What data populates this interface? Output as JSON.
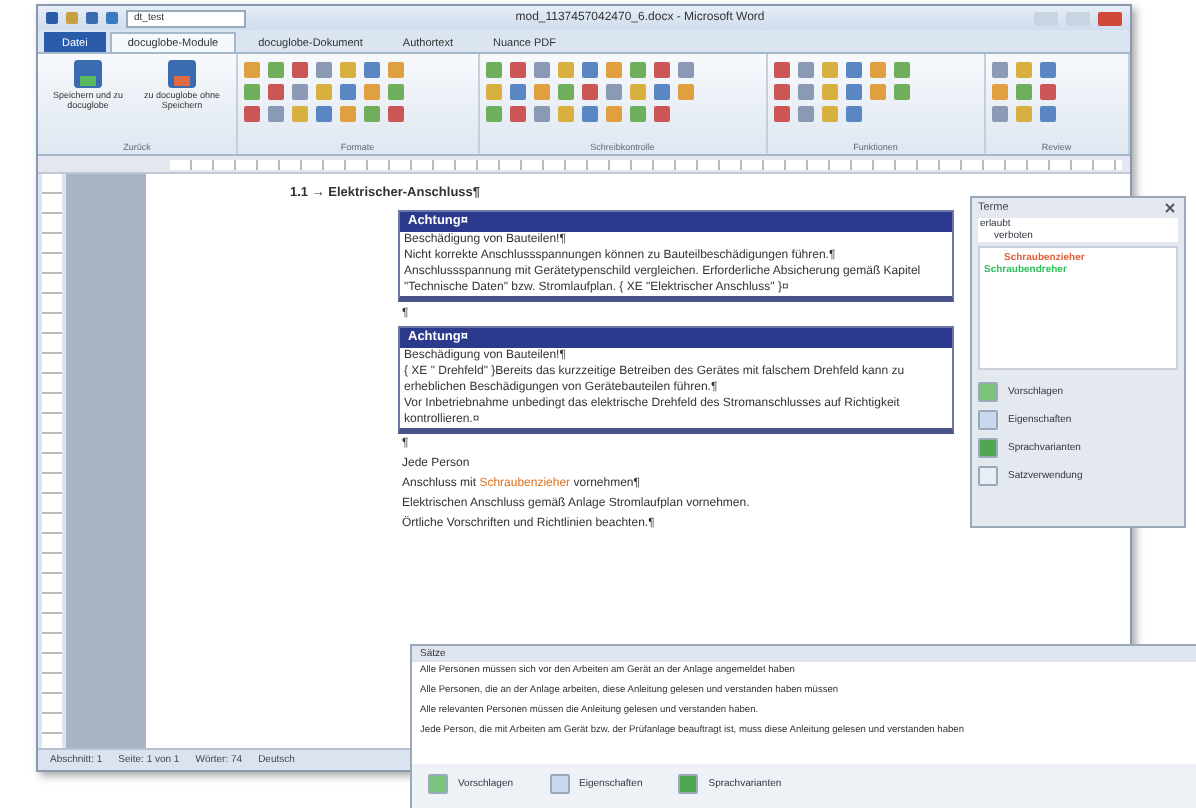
{
  "window": {
    "title": "mod_1137457042470_6.docx - Microsoft Word",
    "quick_access_field": "dt_test"
  },
  "tabs": [
    {
      "label": "Datei",
      "kind": "file",
      "selected": false
    },
    {
      "label": "docuglobe-Module",
      "kind": "tab",
      "selected": true
    },
    {
      "label": "docuglobe-Dokument",
      "kind": "tab",
      "selected": false
    },
    {
      "label": "Authortext",
      "kind": "tab",
      "selected": false
    },
    {
      "label": "Nuance PDF",
      "kind": "tab",
      "selected": false
    }
  ],
  "ribbon_groups": [
    {
      "label": "Zurück",
      "buttons": [
        "Speichern und zu docuglobe",
        "zu docuglobe ohne Speichern"
      ]
    },
    {
      "label": "Formate"
    },
    {
      "label": "Schreibkontrolle"
    },
    {
      "label": "Funktionen"
    },
    {
      "label": "Review"
    }
  ],
  "document": {
    "heading": "1.1 → Elektrischer-Anschluss¶",
    "notes": [
      {
        "title": "Achtung¤",
        "lines": [
          "Beschädigung von Bauteilen!¶",
          "Nicht korrekte Anschlussspannungen können zu Bauteilbeschädigungen führen.¶",
          "Anschlussspannung mit Gerätetypenschild vergleichen. Erforderliche Absicherung gemäß Kapitel \"Technische Daten\" bzw. Stromlaufplan. { XE \"Elektrischer Anschluss\" }¤"
        ]
      },
      {
        "title": "Achtung¤",
        "lines": [
          "Beschädigung von Bauteilen!¶",
          "{ XE \" Drehfeld\" }Bereits das kurzzeitige Betreiben des Gerätes mit falschem Drehfeld kann zu erheblichen Beschädigungen von Gerätebauteilen führen.¶",
          "Vor Inbetriebnahme unbedingt das elektrische Drehfeld des Stromanschlusses auf Richtigkeit kontrollieren.¤"
        ]
      }
    ],
    "between": "¶",
    "paragraphs": [
      [
        {
          "text": "¶",
          "kind": "plain"
        }
      ],
      [
        {
          "text": "Jede Person",
          "kind": "plain"
        }
      ],
      [
        {
          "text": "Anschluss mit ",
          "kind": "plain"
        },
        {
          "text": "Schraubenzieher",
          "kind": "flagged"
        },
        {
          "text": " vornehmen¶",
          "kind": "plain"
        }
      ],
      [
        {
          "text": "Elektrischen Anschluss gemäß Anlage Stromlaufplan vornehmen.",
          "kind": "plain"
        }
      ],
      [
        {
          "text": "Örtliche Vorschriften und Richtlinien beachten.¶",
          "kind": "plain"
        }
      ]
    ]
  },
  "status_bar": [
    "Abschnitt: 1",
    "Seite: 1 von 1",
    "Wörter: 74",
    "Deutsch"
  ],
  "terms_pane": {
    "title": "Terme",
    "tree": [
      {
        "label": "erlaubt",
        "children": [
          {
            "label": "verboten"
          }
        ]
      }
    ],
    "terms": [
      {
        "label": "Schraubenzieher",
        "color": "#e0603a"
      },
      {
        "label": "Schraubendreher",
        "color": "#2fbf5a"
      }
    ],
    "actions": [
      {
        "label": "Vorschlagen",
        "kind": "suggest"
      },
      {
        "label": "Eigenschaften",
        "kind": "properties"
      },
      {
        "label": "Sprachvarianten",
        "kind": "languages"
      },
      {
        "label": "Satzverwendung",
        "kind": "usage"
      }
    ]
  },
  "sentences_pane": {
    "title": "Sätze",
    "sentences": [
      "Alle Personen müssen sich vor den Arbeiten am Gerät an der Anlage angemeldet haben",
      "Alle Personen, die an der Anlage arbeiten, diese Anleitung gelesen und verstanden haben müssen",
      "Alle relevanten Personen müssen die Anleitung gelesen und verstanden haben.",
      "Jede Person, die mit Arbeiten am Gerät bzw. der Prüfanlage beauftragt ist, muss diese Anleitung gelesen und verstanden haben"
    ],
    "actions": [
      {
        "label": "Vorschlagen",
        "kind": "suggest"
      },
      {
        "label": "Eigenschaften",
        "kind": "properties"
      },
      {
        "label": "Sprachvarianten",
        "kind": "languages"
      }
    ]
  }
}
